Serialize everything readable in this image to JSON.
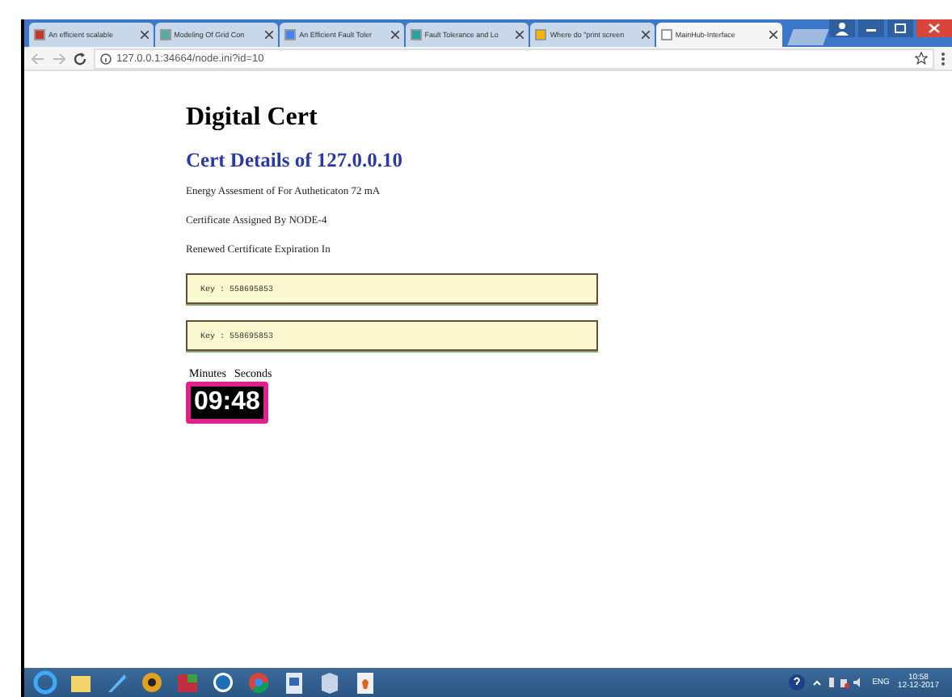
{
  "browser": {
    "tabs": [
      {
        "title": "An efficient scalable",
        "selected": false
      },
      {
        "title": "Modeling Of Grid Con",
        "selected": false
      },
      {
        "title": "An Efficient Fault Toler",
        "selected": false
      },
      {
        "title": "Fault Tolerance and Lo",
        "selected": false
      },
      {
        "title": "Where do \"print screen",
        "selected": false
      },
      {
        "title": "MainHub-Interface",
        "selected": true
      }
    ],
    "url": "127.0.0.1:34664/node.ini?id=10"
  },
  "page": {
    "title": "Digital Cert",
    "subtitle": "Cert Details of 127.0.0.10",
    "lines": [
      "Energy Assesment of For Autheticaton 72 mA",
      "Certificate Assigned By NODE-4",
      "Renewed Certificate Expiration In"
    ],
    "keys": [
      "Key : 558695853",
      "Key : 558695853"
    ],
    "timer": {
      "minutes_label": "Minutes",
      "seconds_label": "Seconds",
      "value": "09:48"
    }
  },
  "taskbar": {
    "time": "10:58",
    "date": "12-12-2017",
    "language": "ENG"
  }
}
